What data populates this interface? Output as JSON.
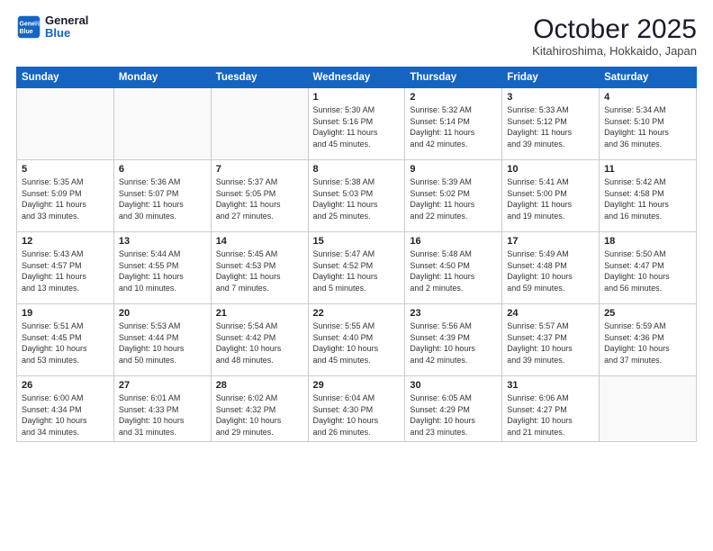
{
  "header": {
    "logo_line1": "General",
    "logo_line2": "Blue",
    "month_title": "October 2025",
    "location": "Kitahiroshima, Hokkaido, Japan"
  },
  "weekdays": [
    "Sunday",
    "Monday",
    "Tuesday",
    "Wednesday",
    "Thursday",
    "Friday",
    "Saturday"
  ],
  "weeks": [
    [
      {
        "day": "",
        "text": ""
      },
      {
        "day": "",
        "text": ""
      },
      {
        "day": "",
        "text": ""
      },
      {
        "day": "1",
        "text": "Sunrise: 5:30 AM\nSunset: 5:16 PM\nDaylight: 11 hours\nand 45 minutes."
      },
      {
        "day": "2",
        "text": "Sunrise: 5:32 AM\nSunset: 5:14 PM\nDaylight: 11 hours\nand 42 minutes."
      },
      {
        "day": "3",
        "text": "Sunrise: 5:33 AM\nSunset: 5:12 PM\nDaylight: 11 hours\nand 39 minutes."
      },
      {
        "day": "4",
        "text": "Sunrise: 5:34 AM\nSunset: 5:10 PM\nDaylight: 11 hours\nand 36 minutes."
      }
    ],
    [
      {
        "day": "5",
        "text": "Sunrise: 5:35 AM\nSunset: 5:09 PM\nDaylight: 11 hours\nand 33 minutes."
      },
      {
        "day": "6",
        "text": "Sunrise: 5:36 AM\nSunset: 5:07 PM\nDaylight: 11 hours\nand 30 minutes."
      },
      {
        "day": "7",
        "text": "Sunrise: 5:37 AM\nSunset: 5:05 PM\nDaylight: 11 hours\nand 27 minutes."
      },
      {
        "day": "8",
        "text": "Sunrise: 5:38 AM\nSunset: 5:03 PM\nDaylight: 11 hours\nand 25 minutes."
      },
      {
        "day": "9",
        "text": "Sunrise: 5:39 AM\nSunset: 5:02 PM\nDaylight: 11 hours\nand 22 minutes."
      },
      {
        "day": "10",
        "text": "Sunrise: 5:41 AM\nSunset: 5:00 PM\nDaylight: 11 hours\nand 19 minutes."
      },
      {
        "day": "11",
        "text": "Sunrise: 5:42 AM\nSunset: 4:58 PM\nDaylight: 11 hours\nand 16 minutes."
      }
    ],
    [
      {
        "day": "12",
        "text": "Sunrise: 5:43 AM\nSunset: 4:57 PM\nDaylight: 11 hours\nand 13 minutes."
      },
      {
        "day": "13",
        "text": "Sunrise: 5:44 AM\nSunset: 4:55 PM\nDaylight: 11 hours\nand 10 minutes."
      },
      {
        "day": "14",
        "text": "Sunrise: 5:45 AM\nSunset: 4:53 PM\nDaylight: 11 hours\nand 7 minutes."
      },
      {
        "day": "15",
        "text": "Sunrise: 5:47 AM\nSunset: 4:52 PM\nDaylight: 11 hours\nand 5 minutes."
      },
      {
        "day": "16",
        "text": "Sunrise: 5:48 AM\nSunset: 4:50 PM\nDaylight: 11 hours\nand 2 minutes."
      },
      {
        "day": "17",
        "text": "Sunrise: 5:49 AM\nSunset: 4:48 PM\nDaylight: 10 hours\nand 59 minutes."
      },
      {
        "day": "18",
        "text": "Sunrise: 5:50 AM\nSunset: 4:47 PM\nDaylight: 10 hours\nand 56 minutes."
      }
    ],
    [
      {
        "day": "19",
        "text": "Sunrise: 5:51 AM\nSunset: 4:45 PM\nDaylight: 10 hours\nand 53 minutes."
      },
      {
        "day": "20",
        "text": "Sunrise: 5:53 AM\nSunset: 4:44 PM\nDaylight: 10 hours\nand 50 minutes."
      },
      {
        "day": "21",
        "text": "Sunrise: 5:54 AM\nSunset: 4:42 PM\nDaylight: 10 hours\nand 48 minutes."
      },
      {
        "day": "22",
        "text": "Sunrise: 5:55 AM\nSunset: 4:40 PM\nDaylight: 10 hours\nand 45 minutes."
      },
      {
        "day": "23",
        "text": "Sunrise: 5:56 AM\nSunset: 4:39 PM\nDaylight: 10 hours\nand 42 minutes."
      },
      {
        "day": "24",
        "text": "Sunrise: 5:57 AM\nSunset: 4:37 PM\nDaylight: 10 hours\nand 39 minutes."
      },
      {
        "day": "25",
        "text": "Sunrise: 5:59 AM\nSunset: 4:36 PM\nDaylight: 10 hours\nand 37 minutes."
      }
    ],
    [
      {
        "day": "26",
        "text": "Sunrise: 6:00 AM\nSunset: 4:34 PM\nDaylight: 10 hours\nand 34 minutes."
      },
      {
        "day": "27",
        "text": "Sunrise: 6:01 AM\nSunset: 4:33 PM\nDaylight: 10 hours\nand 31 minutes."
      },
      {
        "day": "28",
        "text": "Sunrise: 6:02 AM\nSunset: 4:32 PM\nDaylight: 10 hours\nand 29 minutes."
      },
      {
        "day": "29",
        "text": "Sunrise: 6:04 AM\nSunset: 4:30 PM\nDaylight: 10 hours\nand 26 minutes."
      },
      {
        "day": "30",
        "text": "Sunrise: 6:05 AM\nSunset: 4:29 PM\nDaylight: 10 hours\nand 23 minutes."
      },
      {
        "day": "31",
        "text": "Sunrise: 6:06 AM\nSunset: 4:27 PM\nDaylight: 10 hours\nand 21 minutes."
      },
      {
        "day": "",
        "text": ""
      }
    ]
  ]
}
